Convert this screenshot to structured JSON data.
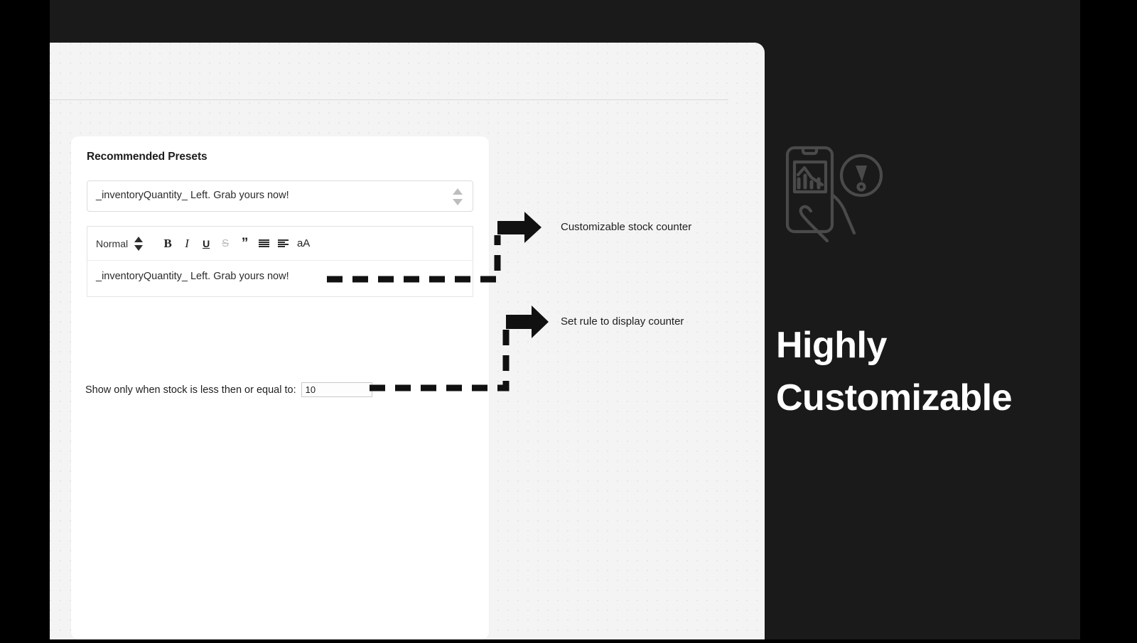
{
  "window": {
    "background_color": "#f4f4f4",
    "frame_color": "#1a1a1a",
    "outer_color": "#000000"
  },
  "settings_card": {
    "title": "Recommended Presets",
    "preset_select": {
      "name": "preset-select",
      "selected_value": "_inventoryQuantity_ Left. Grab yours now!",
      "stepper_icon": "up-down-stepper-icon"
    },
    "editor": {
      "toolbar": {
        "format_label": "Normal",
        "format_stepper_icon": "up-down-stepper-icon",
        "buttons": [
          {
            "name": "bold-button",
            "glyph": "B",
            "label": "Bold"
          },
          {
            "name": "italic-button",
            "glyph": "I",
            "label": "Italic"
          },
          {
            "name": "underline-button",
            "glyph": "U",
            "label": "Underline"
          },
          {
            "name": "strikethrough-button",
            "glyph": "S",
            "label": "Strikethrough"
          },
          {
            "name": "blockquote-button",
            "glyph": "”",
            "label": "Blockquote"
          },
          {
            "name": "list-button",
            "glyph": "",
            "label": "List"
          },
          {
            "name": "align-button",
            "glyph": "",
            "label": "Align"
          },
          {
            "name": "font-size-button",
            "glyph": "aA",
            "label": "Font size"
          }
        ]
      },
      "body_text": "_inventoryQuantity_ Left. Grab yours now!"
    },
    "rule": {
      "label": "Show only when stock is less then or equal to:",
      "input_value": "10"
    }
  },
  "annotations": [
    {
      "id": "annotation-stock-counter",
      "text": "Customizable stock counter",
      "arrow_icon": "right-arrow-icon"
    },
    {
      "id": "annotation-display-rule",
      "text": "Set rule to display counter",
      "arrow_icon": "right-arrow-icon"
    }
  ],
  "feature_panel": {
    "icon_name": "phone-chart-alert-icon",
    "title_lines": [
      "Highly",
      "Customizable"
    ],
    "text_color": "#ffffff",
    "background_color": "#1a1a1a"
  }
}
